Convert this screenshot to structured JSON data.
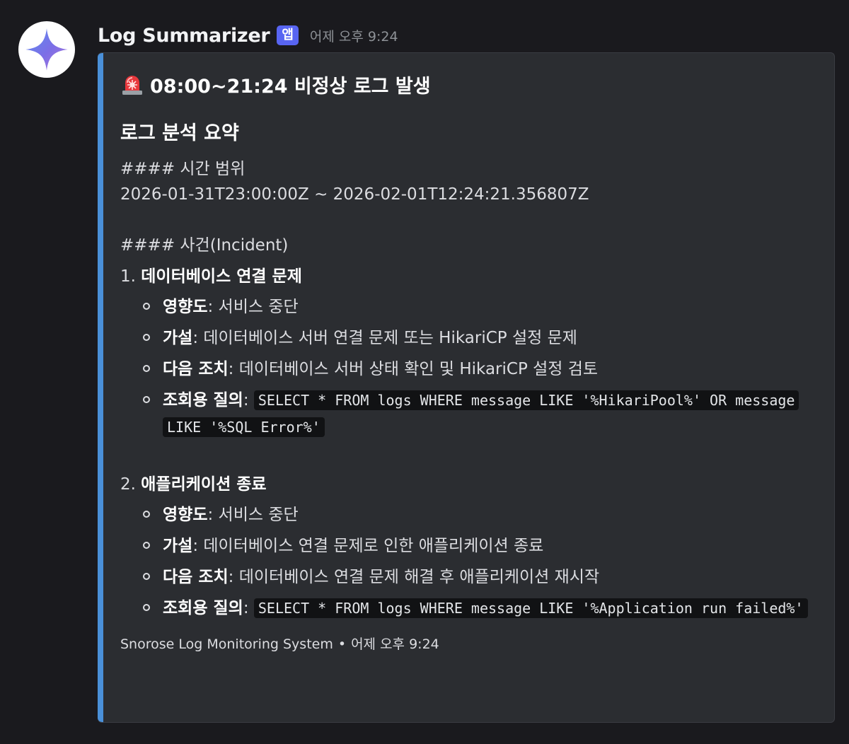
{
  "message": {
    "author": "Log Summarizer",
    "app_badge": "앱",
    "timestamp": "어제 오후 9:24",
    "avatar_icon": "sparkle-icon",
    "accent_color": "#4a90d9"
  },
  "embed": {
    "title_icon": "rotating-light-icon",
    "title": "08:00~21:24 비정상 로그 발생",
    "section_title": "로그 분석 요약",
    "time_range_heading": "#### 시간 범위",
    "time_range": "2026-01-31T23:00:00Z ~ 2026-02-01T12:24:21.356807Z",
    "incidents_heading": "#### 사건(Incident)",
    "incidents": [
      {
        "number": "1.",
        "title": "데이터베이스 연결 문제",
        "impact_label": "영향도",
        "impact": ": 서비스 중단",
        "hypothesis_label": "가설",
        "hypothesis": ": 데이터베이스 서버 연결 문제 또는 HikariCP 설정 문제",
        "action_label": "다음 조치",
        "action": ": 데이터베이스 서버 상태 확인 및 HikariCP 설정 검토",
        "query_label": "조회용 질의",
        "query_sep": ": ",
        "query": "SELECT * FROM logs WHERE message LIKE '%HikariPool%' OR message LIKE '%SQL Error%'"
      },
      {
        "number": "2.",
        "title": "애플리케이션 종료",
        "impact_label": "영향도",
        "impact": ": 서비스 중단",
        "hypothesis_label": "가설",
        "hypothesis": ": 데이터베이스 연결 문제로 인한 애플리케이션 종료",
        "action_label": "다음 조치",
        "action": ": 데이터베이스 연결 문제 해결 후 애플리케이션 재시작",
        "query_label": "조회용 질의",
        "query_sep": ": ",
        "query": "SELECT * FROM logs WHERE message LIKE '%Application run failed%'"
      }
    ],
    "footer_source": "Snorose Log Monitoring System",
    "footer_separator": "•",
    "footer_time": "어제 오후 9:24"
  }
}
